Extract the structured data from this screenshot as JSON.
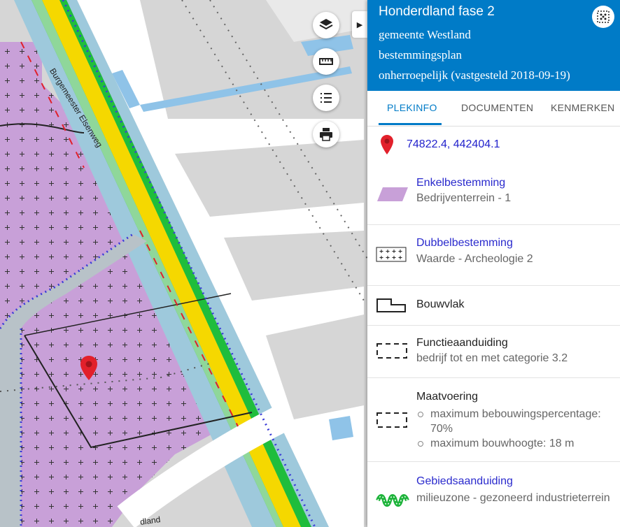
{
  "map": {
    "street_label": "Burgemeester Elsenweg",
    "street_label_bottom": "dland",
    "buttons": {
      "layers_icon": "layers-icon",
      "measure_icon": "ruler-icon",
      "legend_icon": "list-icon",
      "print_icon": "print-icon"
    }
  },
  "panel": {
    "title": "Honderdland fase 2",
    "municipality": "gemeente Westland",
    "plan_type": "bestemmingsplan",
    "status": "onherroepelijk (vastgesteld 2018-09-19)",
    "tabs": [
      {
        "label": "PLEKINFO",
        "active": true
      },
      {
        "label": "DOCUMENTEN",
        "active": false
      },
      {
        "label": "KENMERKEN",
        "active": false
      }
    ],
    "coordinates": "74822.4, 442404.1",
    "items": [
      {
        "title": "Enkelbestemming",
        "subtitle": "Bedrijventerrein - 1",
        "icon": "parallelogram-purple-icon"
      },
      {
        "title": "Dubbelbestemming",
        "subtitle": "Waarde - Archeologie 2",
        "icon": "crosshatch-box-icon"
      },
      {
        "title": "Bouwvlak",
        "icon": "building-outline-icon"
      },
      {
        "title": "Functieaanduiding",
        "subtitle": "bedrijf tot en met categorie 3.2",
        "icon": "dashed-box-icon"
      },
      {
        "title": "Maatvoering",
        "bullets": [
          "maximum bebouwingspercentage: 70%",
          "maximum bouwhoogte: 18 m"
        ],
        "icon": "dashed-box-icon"
      },
      {
        "title": "Gebiedsaanduiding",
        "subtitle": "milieuzone - gezoneerd industrieterrein",
        "icon": "zigzag-green-icon"
      }
    ]
  },
  "colors": {
    "header": "#007bc7",
    "enkelbestemming": "#c8a0d8",
    "road_yellow": "#f5d800",
    "link": "#2a2acd"
  }
}
